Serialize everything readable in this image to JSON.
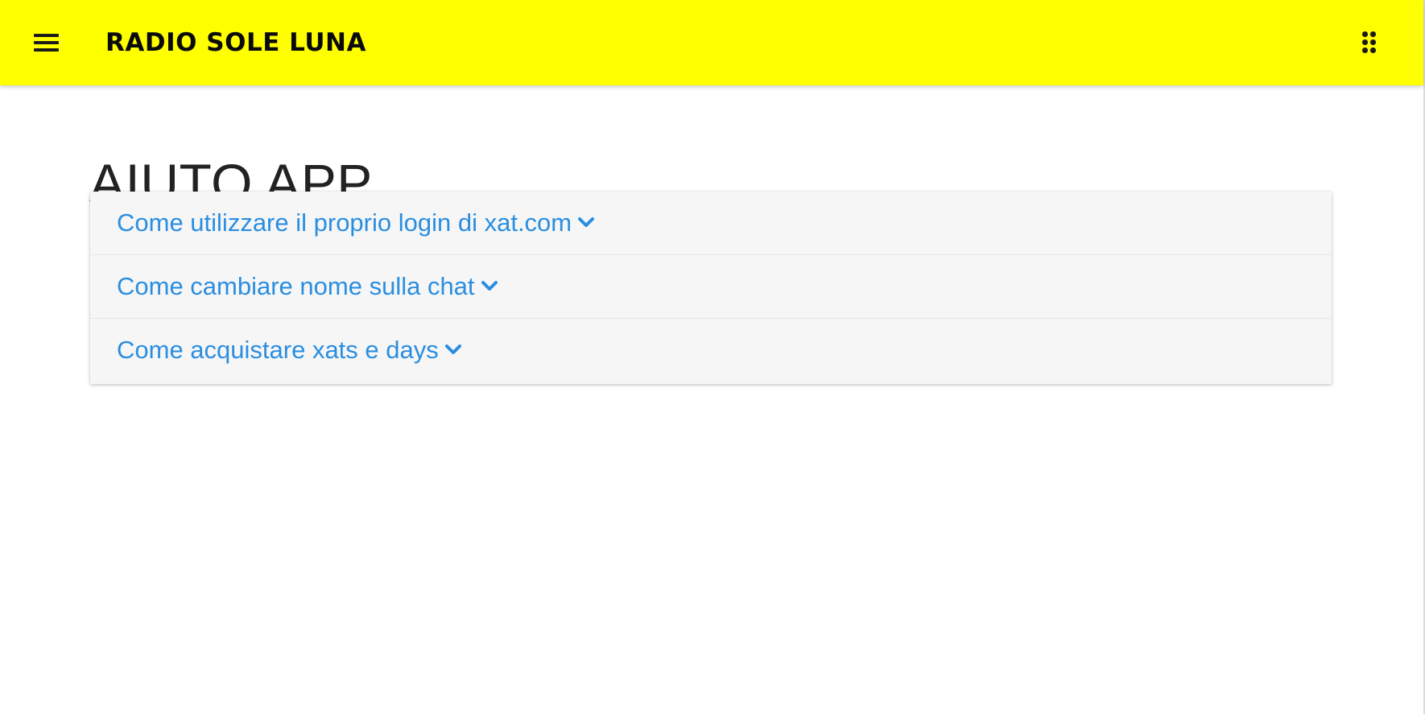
{
  "appbar": {
    "title": "RADIO SOLE LUNA",
    "background_color": "#ffff00",
    "menu_icon": "hamburger-menu-icon",
    "apps_icon": "apps-grid-icon"
  },
  "main": {
    "heading": "AIUTO APP",
    "faq": [
      {
        "label": "Come utilizzare il proprio login di xat.com",
        "icon": "chevron-down-icon"
      },
      {
        "label": "Come cambiare nome sulla chat",
        "icon": "chevron-down-icon"
      },
      {
        "label": "Come acquistare xats e days",
        "icon": "chevron-down-icon"
      }
    ],
    "link_color": "#2a8ee0"
  }
}
